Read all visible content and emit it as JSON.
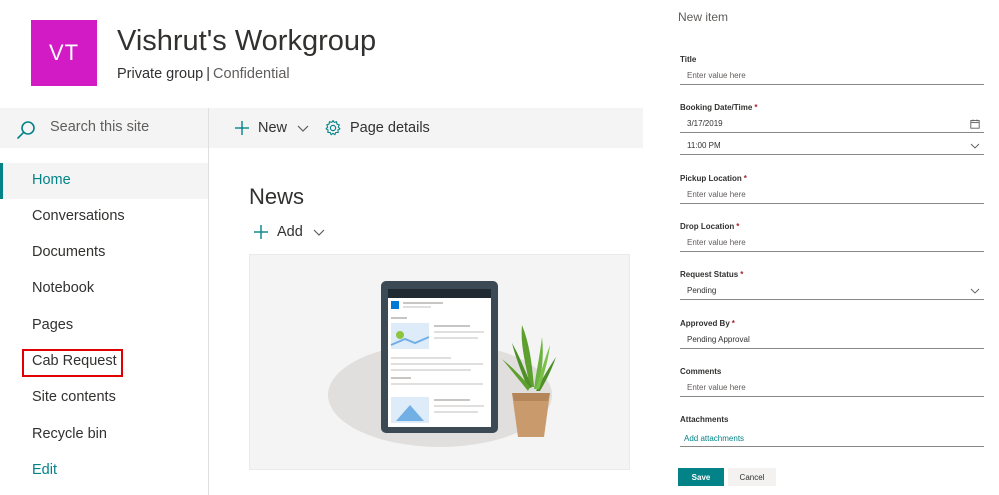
{
  "site": {
    "logo_initials": "VT",
    "title": "Vishrut's Workgroup",
    "group_type": "Private group",
    "separator": "|",
    "classification": "Confidential",
    "logo_color": "#d21bc4"
  },
  "search": {
    "placeholder": "Search this site"
  },
  "nav": {
    "items": [
      {
        "label": "Home",
        "active": true
      },
      {
        "label": "Conversations"
      },
      {
        "label": "Documents"
      },
      {
        "label": "Notebook"
      },
      {
        "label": "Pages"
      },
      {
        "label": "Cab Request",
        "highlighted": true
      },
      {
        "label": "Site contents"
      },
      {
        "label": "Recycle bin"
      },
      {
        "label": "Edit"
      }
    ]
  },
  "command_bar": {
    "new_label": "New",
    "page_details_label": "Page details"
  },
  "news": {
    "title": "News",
    "add_label": "Add"
  },
  "panel": {
    "title": "New item",
    "fields": {
      "title": {
        "label": "Title",
        "placeholder": "Enter value here"
      },
      "booking": {
        "label": "Booking Date/Time",
        "required": "*",
        "date": "3/17/2019",
        "time": "11:00 PM"
      },
      "pickup": {
        "label": "Pickup Location",
        "required": "*",
        "placeholder": "Enter value here"
      },
      "drop": {
        "label": "Drop Location",
        "required": "*",
        "placeholder": "Enter value here"
      },
      "status": {
        "label": "Request Status",
        "required": "*",
        "value": "Pending"
      },
      "approved": {
        "label": "Approved By",
        "required": "*",
        "value": "Pending Approval"
      },
      "comments": {
        "label": "Comments",
        "placeholder": "Enter value here"
      },
      "attachments": {
        "label": "Attachments",
        "link": "Add attachments"
      }
    },
    "save_label": "Save",
    "cancel_label": "Cancel"
  },
  "colors": {
    "accent": "#038387",
    "required": "#a4262c",
    "highlight_border": "#e00000"
  }
}
